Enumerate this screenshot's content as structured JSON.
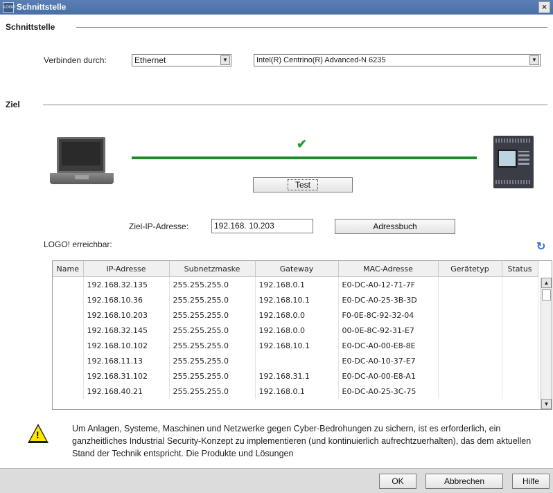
{
  "window": {
    "title": "Schnittstelle",
    "logo_text": "LOGO",
    "close_label": "×"
  },
  "schnittstelle": {
    "heading": "Schnittstelle",
    "connect_label": "Verbinden durch:",
    "connect_value": "Ethernet",
    "adapter_value": "Intel(R) Centrino(R) Advanced-N 6235"
  },
  "ziel": {
    "heading": "Ziel",
    "status_check": "✔",
    "test_label": "Test",
    "target_ip_label": "Ziel-IP-Adresse:",
    "target_ip_value": "192.168. 10.203",
    "addressbook_label": "Adressbuch",
    "reachable_label": "LOGO! erreichbar:",
    "connection_color": "#1a8c2a"
  },
  "table": {
    "columns": [
      "Name",
      "IP-Adresse",
      "Subnetzmaske",
      "Gateway",
      "MAC-Adresse",
      "Gerätetyp",
      "Status"
    ],
    "rows": [
      [
        "",
        "192.168.32.135",
        "255.255.255.0",
        "192.168.0.1",
        "E0-DC-A0-12-71-7F",
        "",
        ""
      ],
      [
        "",
        "192.168.10.36",
        "255.255.255.0",
        "192.168.10.1",
        "E0-DC-A0-25-3B-3D",
        "",
        ""
      ],
      [
        "",
        "192.168.10.203",
        "255.255.255.0",
        "192.168.0.0",
        "F0-0E-8C-92-32-04",
        "",
        ""
      ],
      [
        "",
        "192.168.32.145",
        "255.255.255.0",
        "192.168.0.0",
        "00-0E-8C-92-31-E7",
        "",
        ""
      ],
      [
        "",
        "192.168.10.102",
        "255.255.255.0",
        "192.168.10.1",
        "E0-DC-A0-00-E8-8E",
        "",
        ""
      ],
      [
        "",
        "192.168.11.13",
        "255.255.255.0",
        "",
        "E0-DC-A0-10-37-E7",
        "",
        ""
      ],
      [
        "",
        "192.168.31.102",
        "255.255.255.0",
        "192.168.31.1",
        "E0-DC-A0-00-E8-A1",
        "",
        ""
      ],
      [
        "",
        "192.168.40.21",
        "255.255.255.0",
        "192.168.0.1",
        "E0-DC-A0-25-3C-75",
        "",
        ""
      ]
    ]
  },
  "warning": {
    "text": "Um Anlagen, Systeme, Maschinen und Netzwerke gegen Cyber-Bedrohungen zu sichern, ist es erforderlich, ein ganzheitliches Industrial Security-Konzept zu implementieren (und kontinuierlich aufrechtzuerhalten), das dem aktuellen Stand der Technik entspricht. Die Produkte und Lösungen"
  },
  "footer": {
    "ok_label": "OK",
    "cancel_label": "Abbrechen",
    "help_label": "Hilfe"
  }
}
